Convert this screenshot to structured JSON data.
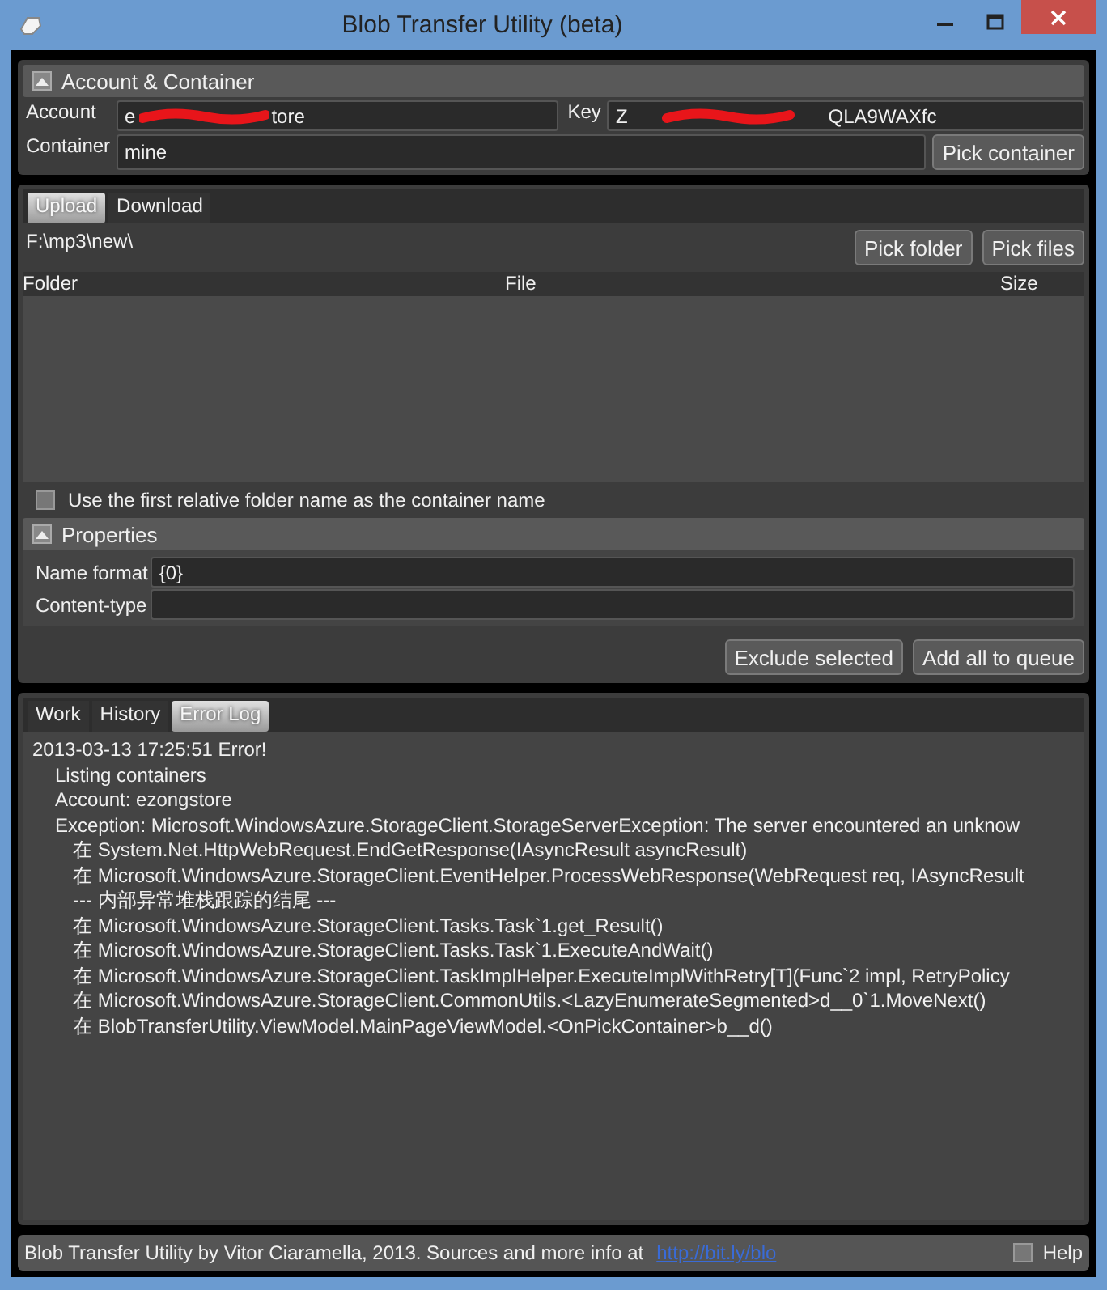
{
  "window": {
    "title": "Blob Transfer Utility (beta)"
  },
  "account_section": {
    "title": "Account & Container",
    "expanded": true,
    "account": {
      "label": "Account",
      "value_start": "e",
      "value_end": "tore"
    },
    "key": {
      "label": "Key",
      "value_start": "Z",
      "value_end": "QLA9WAXfc"
    },
    "container": {
      "label": "Container",
      "value": "mine"
    },
    "pick_container": "Pick container"
  },
  "transfer_tabs": [
    {
      "label": "Upload",
      "selected": true
    },
    {
      "label": "Download",
      "selected": false
    }
  ],
  "upload": {
    "path": "F:\\mp3\\new\\",
    "buttons": [
      "Pick folder",
      "Pick files"
    ],
    "table": {
      "columns": [
        "Folder",
        "File",
        "Size"
      ]
    },
    "use_folder_name": {
      "label": "Use the first relative folder name as the container name",
      "checked": false
    },
    "properties": {
      "title": "Properties",
      "expanded": true,
      "fields": [
        {
          "label": "Name format",
          "value": "{0}"
        },
        {
          "label": "Content-type"
        }
      ]
    },
    "actions": [
      "Exclude selected",
      "Add all to queue"
    ]
  },
  "log_tabs": [
    {
      "label": "Work",
      "selected": false
    },
    {
      "label": "History",
      "selected": false
    },
    {
      "label": "Error Log",
      "selected": true
    }
  ],
  "error_log": [
    {
      "text": "2013-03-13 17:25:51 Error!",
      "children": [
        {
          "text": "Listing containers"
        },
        {
          "text": "Account: ezongstore"
        },
        {
          "text": "Exception: Microsoft.WindowsAzure.StorageClient.StorageServerException: The server encountered an unknow",
          "children": [
            {
              "text": "在 System.Net.HttpWebRequest.EndGetResponse(IAsyncResult asyncResult)"
            },
            {
              "text": "在 Microsoft.WindowsAzure.StorageClient.EventHelper.ProcessWebResponse(WebRequest req, IAsyncResult"
            },
            {
              "text": "--- 内部异常堆栈跟踪的结尾 ---"
            },
            {
              "text": "在 Microsoft.WindowsAzure.StorageClient.Tasks.Task`1.get_Result()"
            },
            {
              "text": "在 Microsoft.WindowsAzure.StorageClient.Tasks.Task`1.ExecuteAndWait()"
            },
            {
              "text": "在 Microsoft.WindowsAzure.StorageClient.TaskImplHelper.ExecuteImplWithRetry[T](Func`2 impl, RetryPolicy"
            },
            {
              "text": "在 Microsoft.WindowsAzure.StorageClient.CommonUtils.<LazyEnumerateSegmented>d__0`1.MoveNext()"
            },
            {
              "text": "在 BlobTransferUtility.ViewModel.MainPageViewModel.<OnPickContainer>b__d()"
            }
          ]
        }
      ]
    }
  ],
  "status_bar": {
    "text": "Blob Transfer Utility by Vitor Ciaramella, 2013. Sources and more info at",
    "link": "http://bit.ly/blo",
    "help": {
      "label": "Help",
      "checked": false
    }
  }
}
